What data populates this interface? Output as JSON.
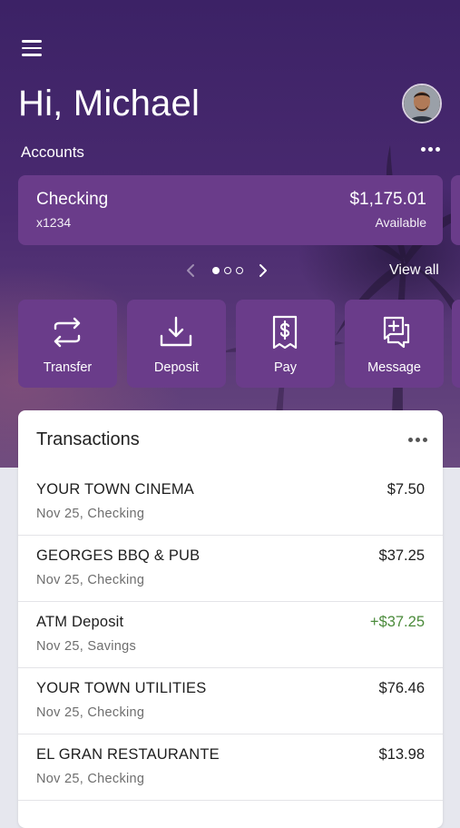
{
  "header": {
    "greeting": "Hi, Michael"
  },
  "accounts": {
    "label": "Accounts",
    "card": {
      "name": "Checking",
      "number": "x1234",
      "balance": "$1,175.01",
      "balance_label": "Available"
    },
    "view_all": "View all"
  },
  "actions": [
    {
      "label": "Transfer",
      "icon": "transfer-icon"
    },
    {
      "label": "Deposit",
      "icon": "deposit-icon"
    },
    {
      "label": "Pay",
      "icon": "pay-icon"
    },
    {
      "label": "Message",
      "icon": "message-icon"
    }
  ],
  "transactions": {
    "title": "Transactions",
    "items": [
      {
        "name": "YOUR TOWN CINEMA",
        "detail": "Nov 25, Checking",
        "amount": "$7.50",
        "positive": false
      },
      {
        "name": "GEORGES BBQ & PUB",
        "detail": "Nov 25, Checking",
        "amount": "$37.25",
        "positive": false
      },
      {
        "name": "ATM Deposit",
        "detail": "Nov 25, Savings",
        "amount": "+$37.25",
        "positive": true
      },
      {
        "name": "YOUR TOWN UTILITIES",
        "detail": "Nov 25, Checking",
        "amount": "$76.46",
        "positive": false
      },
      {
        "name": "EL GRAN RESTAURANTE",
        "detail": "Nov 25, Checking",
        "amount": "$13.98",
        "positive": false
      }
    ]
  },
  "colors": {
    "accent": "#6a3c8a",
    "positive": "#4b8b3b",
    "background": "#e6e7ee"
  }
}
